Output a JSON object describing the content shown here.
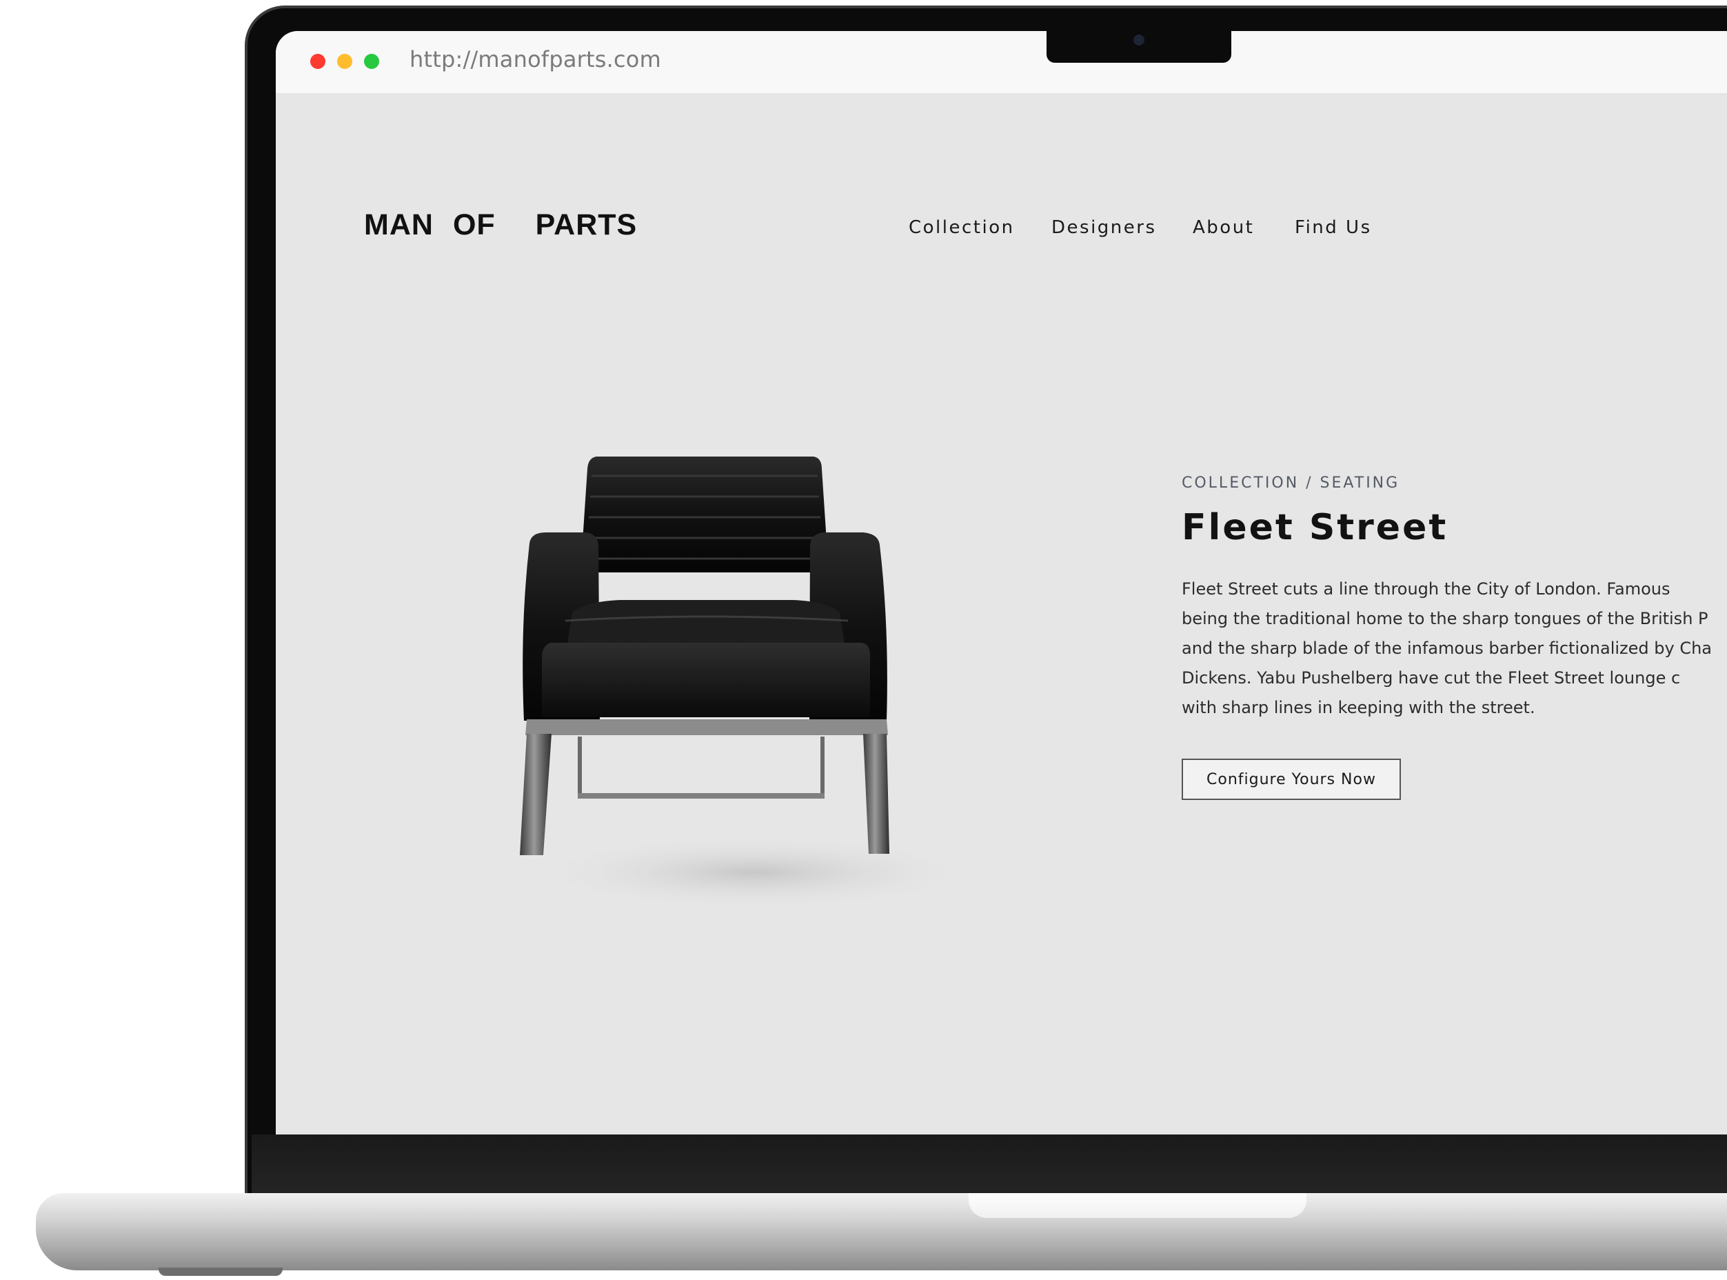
{
  "browser": {
    "url": "http://manofparts.com"
  },
  "site": {
    "logo": [
      "MAN",
      "OF",
      "PARTS"
    ],
    "nav": [
      "Collection",
      "Designers",
      "About",
      "Find Us"
    ]
  },
  "product": {
    "breadcrumb": "COLLECTION / SEATING",
    "title": "Fleet Street",
    "description_lines": [
      "Fleet Street cuts a line through the City of London. Famous",
      "being the traditional home to the sharp tongues of the British P",
      "and the sharp blade of the infamous barber fictionalized by Cha",
      "Dickens. Yabu Pushelberg have cut the Fleet Street lounge c",
      "with sharp lines in keeping with the street."
    ],
    "cta_label": "Configure Yours Now"
  },
  "colors": {
    "page_background": "#e6e6e6",
    "traffic_red": "#ff3b30",
    "traffic_yellow": "#ffbd2e",
    "traffic_green": "#28c840"
  },
  "icons": [
    "close-dot-icon",
    "minimize-dot-icon",
    "maximize-dot-icon",
    "camera-icon"
  ]
}
